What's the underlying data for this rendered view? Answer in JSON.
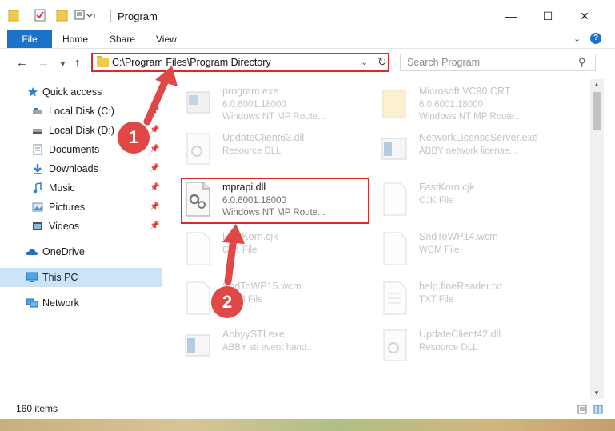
{
  "window": {
    "title": "Program",
    "minimize_icon": "minimize-icon",
    "maximize_icon": "maximize-icon",
    "close_icon": "close-icon"
  },
  "ribbon": {
    "tabs": [
      "File",
      "Home",
      "Share",
      "View"
    ],
    "accent": "#1a73c9"
  },
  "nav": {
    "address": "C:\\Program Files\\Program Directory",
    "search_placeholder": "Search Program"
  },
  "sidebar": {
    "items": [
      {
        "label": "Quick access",
        "icon": "star-icon",
        "pinned": false
      },
      {
        "label": "Local Disk (C:)",
        "icon": "drive-icon",
        "pinned": true
      },
      {
        "label": "Local Disk (D:)",
        "icon": "drive-icon",
        "pinned": true
      },
      {
        "label": "Documents",
        "icon": "documents-icon",
        "pinned": true
      },
      {
        "label": "Downloads",
        "icon": "download-icon",
        "pinned": true
      },
      {
        "label": "Music",
        "icon": "music-icon",
        "pinned": true
      },
      {
        "label": "Pictures",
        "icon": "pictures-icon",
        "pinned": true
      },
      {
        "label": "Videos",
        "icon": "videos-icon",
        "pinned": true
      },
      {
        "label": "OneDrive",
        "icon": "cloud-icon",
        "pinned": false
      },
      {
        "label": "This PC",
        "icon": "computer-icon",
        "pinned": false,
        "selected": true
      },
      {
        "label": "Network",
        "icon": "network-icon",
        "pinned": false
      }
    ]
  },
  "files": [
    {
      "name": "program.exe",
      "line2": "6.0.6001.18000",
      "line3": "Windows NT MP Route...",
      "icon": "exe-icon"
    },
    {
      "name": "Microsoft.VC90.CRT",
      "line2": "6.0.6001.18000",
      "line3": "Windows NT MP Route...",
      "icon": "folder-icon"
    },
    {
      "name": "UpdateClient63.dll",
      "line2": "Resource DLL",
      "line3": "",
      "icon": "dll-icon"
    },
    {
      "name": "NetworkLicenseServer.exe",
      "line2": "ABBY network license...",
      "line3": "",
      "icon": "exe-icon"
    },
    {
      "name": "mprapi.dll",
      "line2": "6.0.6001.18000",
      "line3": "Windows NT MP Route...",
      "icon": "dll-icon",
      "highlighted": true
    },
    {
      "name": "FastKorn.cjk",
      "line2": "CJK File",
      "line3": "",
      "icon": "file-icon"
    },
    {
      "name": "FastKorn.cjk",
      "line2": "CJK File",
      "line3": "",
      "icon": "file-icon"
    },
    {
      "name": "SndToWP14.wcm",
      "line2": "WCM File",
      "line3": "",
      "icon": "file-icon"
    },
    {
      "name": "SndToWP15.wcm",
      "line2": "WCM File",
      "line3": "",
      "icon": "file-icon"
    },
    {
      "name": "help.fineReader.txt",
      "line2": "TXT File",
      "line3": "",
      "icon": "text-file-icon"
    },
    {
      "name": "AbbyySTI.exe",
      "line2": "ABBY sti event hand...",
      "line3": "",
      "icon": "exe-icon"
    },
    {
      "name": "UpdateClient42.dll",
      "line2": "Resource DLL",
      "line3": "",
      "icon": "dll-icon"
    }
  ],
  "status": {
    "item_count": "160 items"
  },
  "annotations": {
    "badge1": "1",
    "badge2": "2",
    "color": "#e04848"
  }
}
